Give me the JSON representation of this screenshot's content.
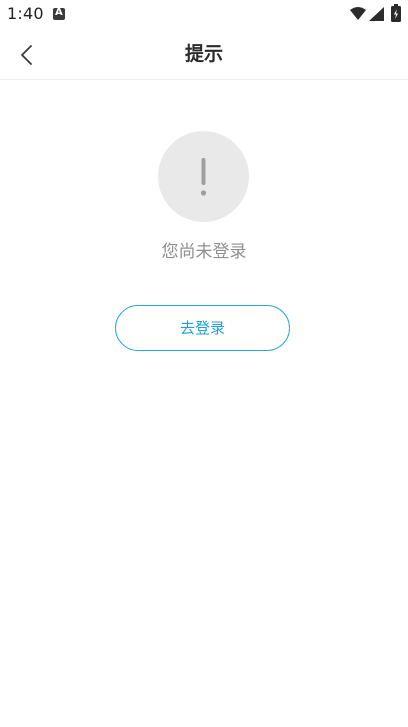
{
  "status_bar": {
    "time": "1:40",
    "notification_icon": "a-notification-icon",
    "wifi_icon": "wifi-icon",
    "signal_icon": "cell-signal-icon",
    "battery_icon": "battery-icon"
  },
  "header": {
    "back_icon": "chevron-left-icon",
    "title": "提示"
  },
  "empty_state": {
    "icon": "exclamation-icon",
    "message": "您尚未登录",
    "login_button_label": "去登录"
  },
  "colors": {
    "accent": "#2aa6dd",
    "icon_circle": "#e9e9e9",
    "message_text": "#8f8f8f"
  }
}
